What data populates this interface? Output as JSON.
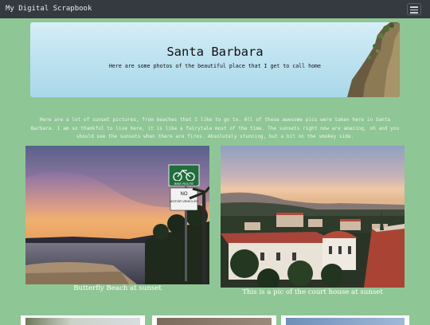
{
  "nav": {
    "brand": "My Digital Scrapbook",
    "menu_icon": "hamburger-icon"
  },
  "hero": {
    "title": "Santa Barbara",
    "subtitle": "Here are some photos of the beautiful place that I get to call home"
  },
  "intro": "Here are a lot of sunset pictures, from beaches that I like to go to. All of these awesome pics were taken here in Santa Barbara. I am so thankful to live here, it is like a fairytale most of the time. The sunsets right now are amazing, oh and you should see the sunsets when there are fires. Absolutely stunning, but a bit on the smokey side.",
  "photos": [
    {
      "caption": "Butterfly Beach at sunset",
      "sign": {
        "top": "BIKE ROUTE",
        "middle": "NO",
        "bottom": "MOTOR VEHICLES"
      }
    },
    {
      "caption": "This is a pic of the court house at sunset"
    }
  ],
  "colors": {
    "page_bg": "#8fc695",
    "navbar_bg": "#343a40"
  }
}
